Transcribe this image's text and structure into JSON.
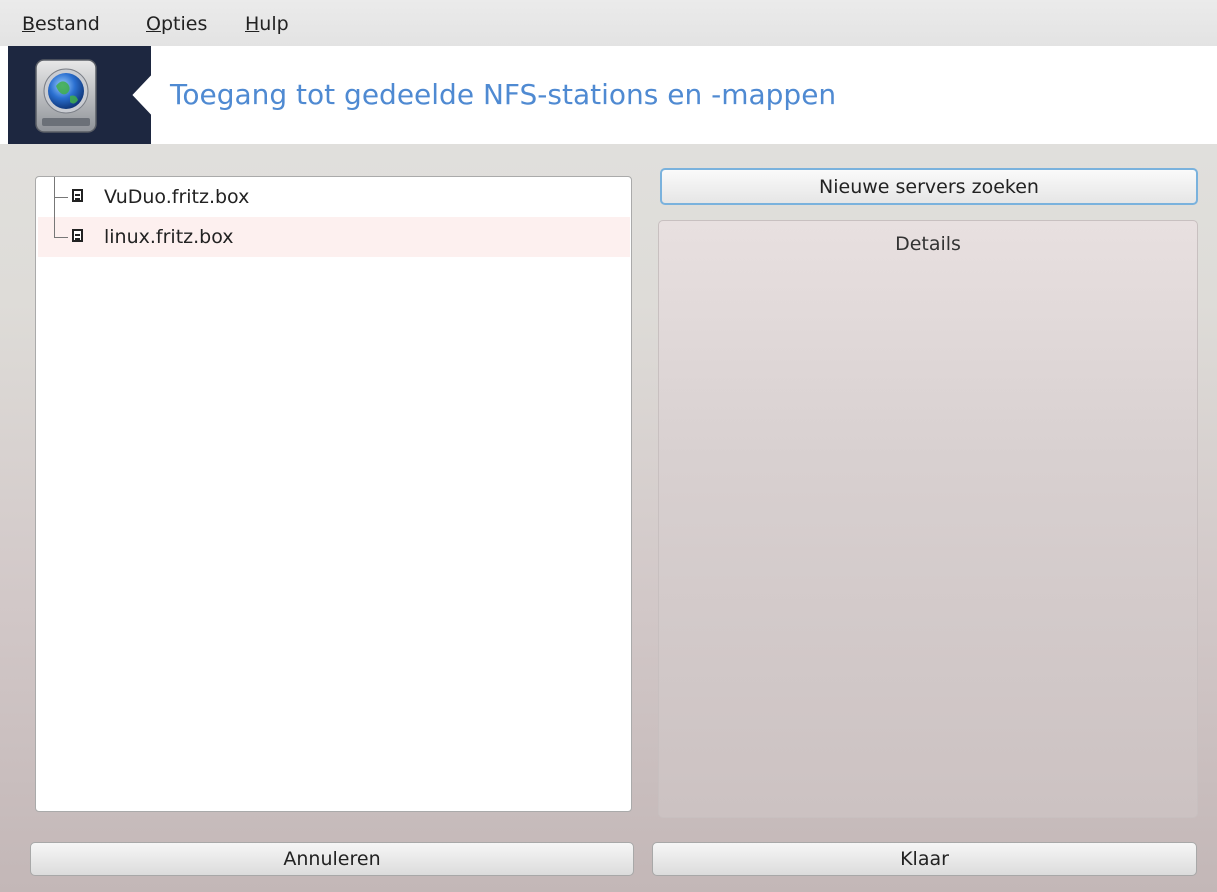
{
  "menubar": {
    "items": [
      {
        "accel": "B",
        "rest": "estand"
      },
      {
        "accel": "O",
        "rest": "pties"
      },
      {
        "accel": "H",
        "rest": "ulp"
      }
    ]
  },
  "banner": {
    "title": "Toegang tot gedeelde NFS-stations en -mappen",
    "logo_icon": "network-drive-icon",
    "accent_color": "#4f8ad2"
  },
  "tree": {
    "items": [
      {
        "label": "VuDuo.fritz.box",
        "icon": "computer-host-icon"
      },
      {
        "label": "linux.fritz.box",
        "icon": "computer-host-icon"
      }
    ]
  },
  "buttons": {
    "search": "Nieuwe servers zoeken",
    "cancel": "Annuleren",
    "done": "Klaar"
  },
  "details": {
    "title": "Details"
  }
}
